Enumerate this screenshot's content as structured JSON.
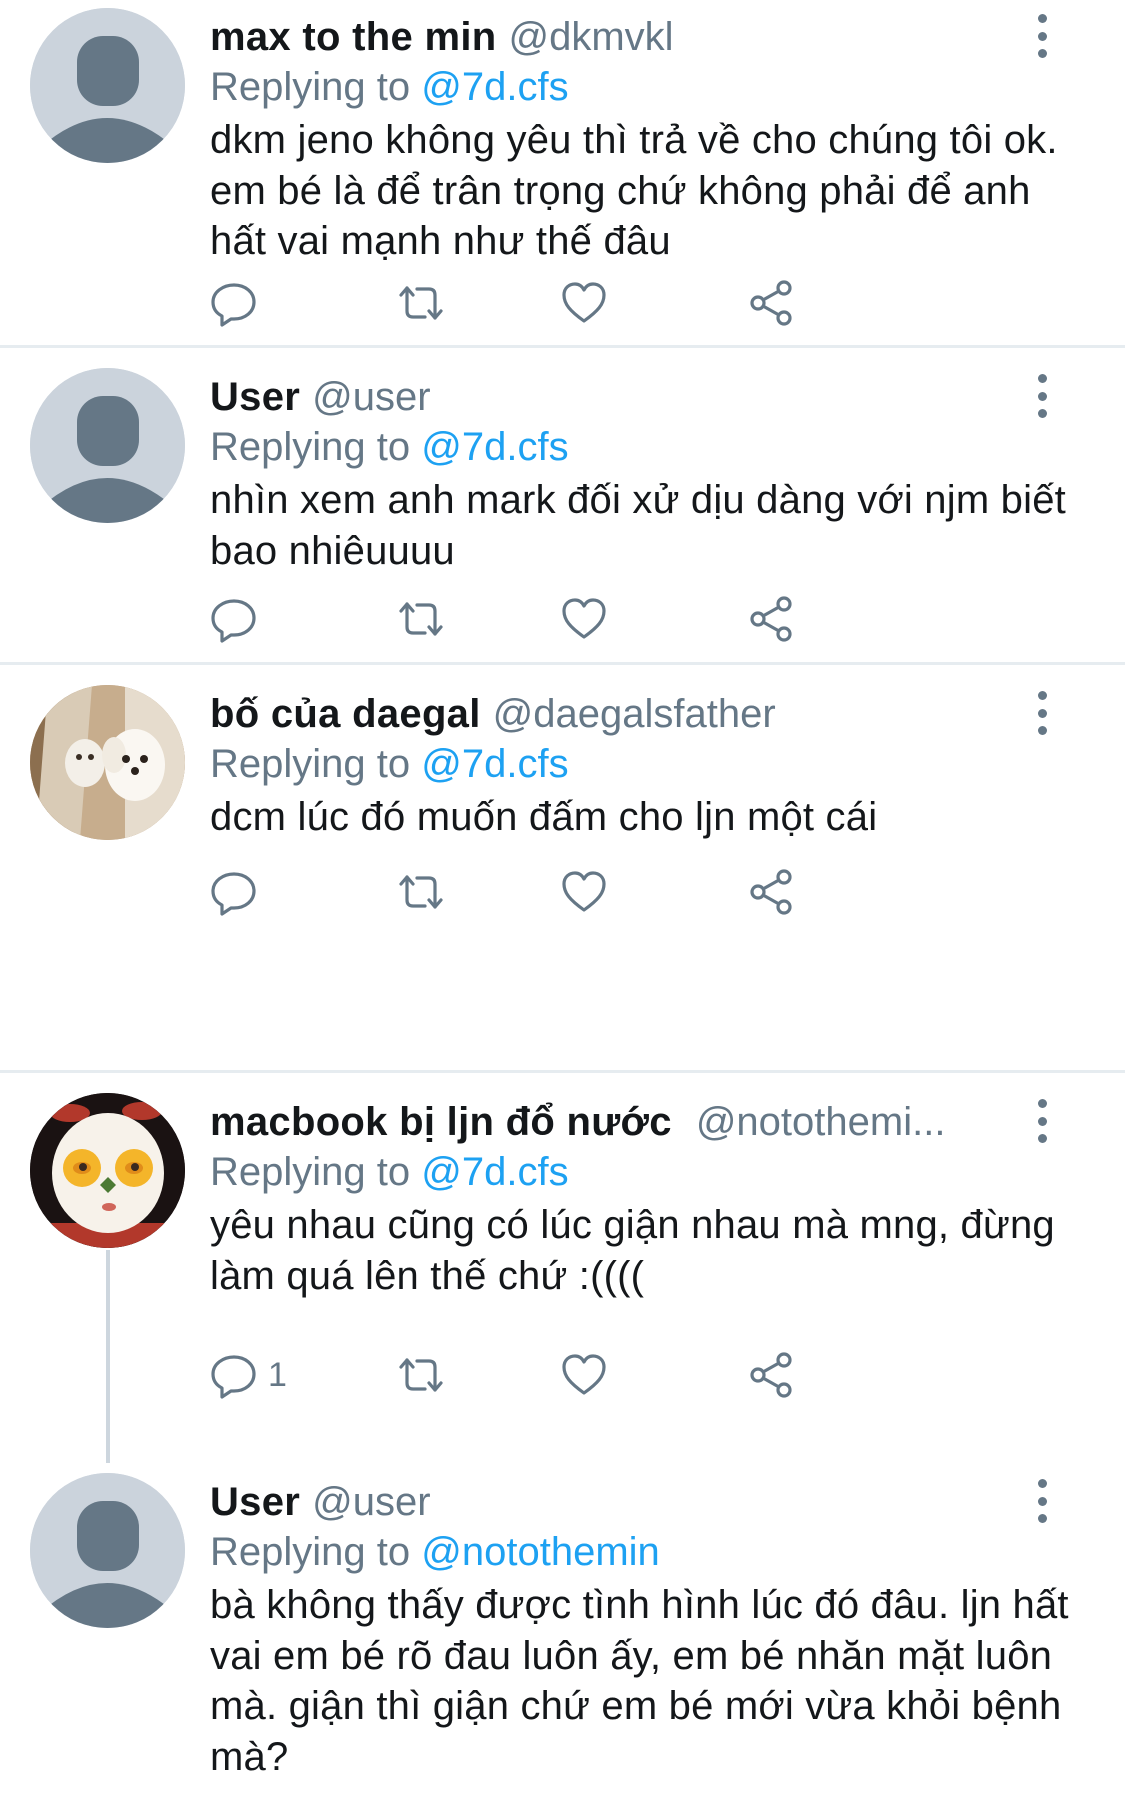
{
  "tweets": [
    {
      "name": "max to the min",
      "handle": "@dkmvkl",
      "replying_prefix": "Replying to",
      "replying_to": "@7d.cfs",
      "text": "dkm jeno không yêu thì trả về cho chúng tôi ok. em bé là để trân trọng chứ không phải để anh hất vai mạnh như thế đâu",
      "avatar": "default-avatar",
      "reply_count": ""
    },
    {
      "name": "User",
      "handle": "@user",
      "replying_prefix": "Replying to",
      "replying_to": "@7d.cfs",
      "text": "nhìn xem anh mark đối xử dịu dàng với njm biết bao nhiêuuuu",
      "avatar": "default-avatar",
      "reply_count": ""
    },
    {
      "name": "bố của daegal",
      "handle": "@daegalsfather",
      "replying_prefix": "Replying to",
      "replying_to": "@7d.cfs",
      "text": "dcm lúc đó muốn đấm cho ljn một cái",
      "avatar": "dog-photo-avatar",
      "reply_count": ""
    },
    {
      "name": "macbook bị ljn đổ nước",
      "handle": "@notothemi...",
      "replying_prefix": "Replying to",
      "replying_to": "@7d.cfs",
      "text": "yêu nhau cũng có lúc giận nhau mà mng, đừng làm quá lên thế chứ :((((",
      "avatar": "egg-face-avatar",
      "reply_count": "1"
    },
    {
      "name": "User",
      "handle": "@user",
      "replying_prefix": "Replying to",
      "replying_to": "@notothemin",
      "text": "bà không thấy được tình hình lúc đó đâu. ljn hất vai em bé rõ đau luôn ấy, em bé nhăn mặt luôn mà. giận thì giận chứ em bé mới vừa khỏi bệnh mà?",
      "avatar": "default-avatar",
      "reply_count": ""
    }
  ],
  "icons": [
    "reply-icon",
    "retweet-icon",
    "like-icon",
    "share-icon",
    "more-icon"
  ],
  "colors": {
    "link": "#1da1f2",
    "secondary": "#657786",
    "icon": "#657786",
    "divider": "#e6ecf0"
  }
}
